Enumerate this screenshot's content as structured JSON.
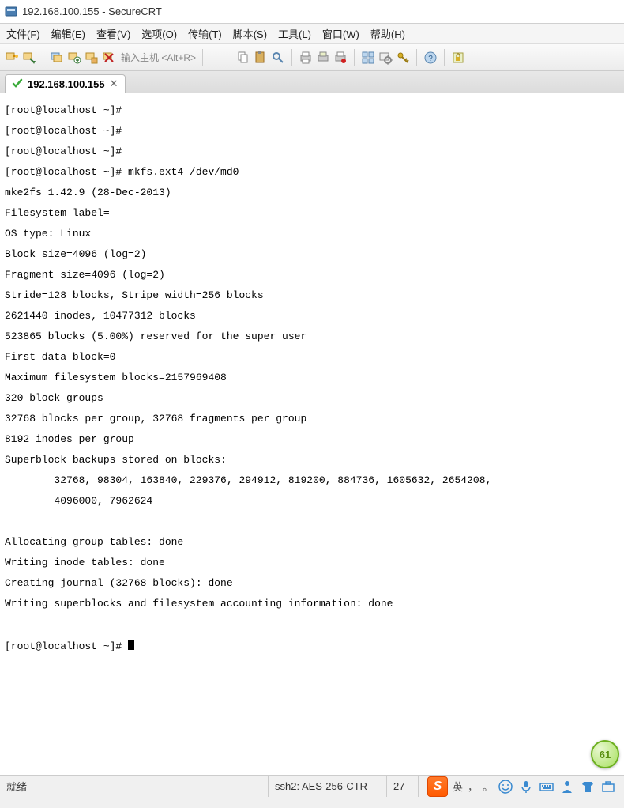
{
  "window": {
    "title": "192.168.100.155 - SecureCRT"
  },
  "menu": {
    "file": "文件(F)",
    "edit": "编辑(E)",
    "view": "查看(V)",
    "options": "选项(O)",
    "transfer": "传输(T)",
    "script": "脚本(S)",
    "tools": "工具(L)",
    "window": "窗口(W)",
    "help": "帮助(H)"
  },
  "toolbar": {
    "host_hint": "输入主机 <Alt+R>"
  },
  "tab": {
    "title": "192.168.100.155",
    "close": "✕"
  },
  "terminal": {
    "l1": "[root@localhost ~]#",
    "l2": "[root@localhost ~]#",
    "l3": "[root@localhost ~]#",
    "l4": "[root@localhost ~]# mkfs.ext4 /dev/md0",
    "l5": "mke2fs 1.42.9 (28-Dec-2013)",
    "l6": "Filesystem label=",
    "l7": "OS type: Linux",
    "l8": "Block size=4096 (log=2)",
    "l9": "Fragment size=4096 (log=2)",
    "l10": "Stride=128 blocks, Stripe width=256 blocks",
    "l11": "2621440 inodes, 10477312 blocks",
    "l12": "523865 blocks (5.00%) reserved for the super user",
    "l13": "First data block=0",
    "l14": "Maximum filesystem blocks=2157969408",
    "l15": "320 block groups",
    "l16": "32768 blocks per group, 32768 fragments per group",
    "l17": "8192 inodes per group",
    "l18": "Superblock backups stored on blocks: ",
    "l19": "        32768, 98304, 163840, 229376, 294912, 819200, 884736, 1605632, 2654208, ",
    "l20": "        4096000, 7962624",
    "l21": "",
    "l22": "Allocating group tables: done",
    "l23": "Writing inode tables: done",
    "l24": "Creating journal (32768 blocks): done",
    "l25": "Writing superblocks and filesystem accounting information: done",
    "l26": "",
    "l27": "[root@localhost ~]# "
  },
  "status": {
    "ready": "就绪",
    "conn": "ssh2: AES-256-CTR",
    "num": "27"
  },
  "ime": {
    "cn": "英",
    "dot1": "，",
    "dot2": "。"
  },
  "badge": {
    "value": "61"
  }
}
